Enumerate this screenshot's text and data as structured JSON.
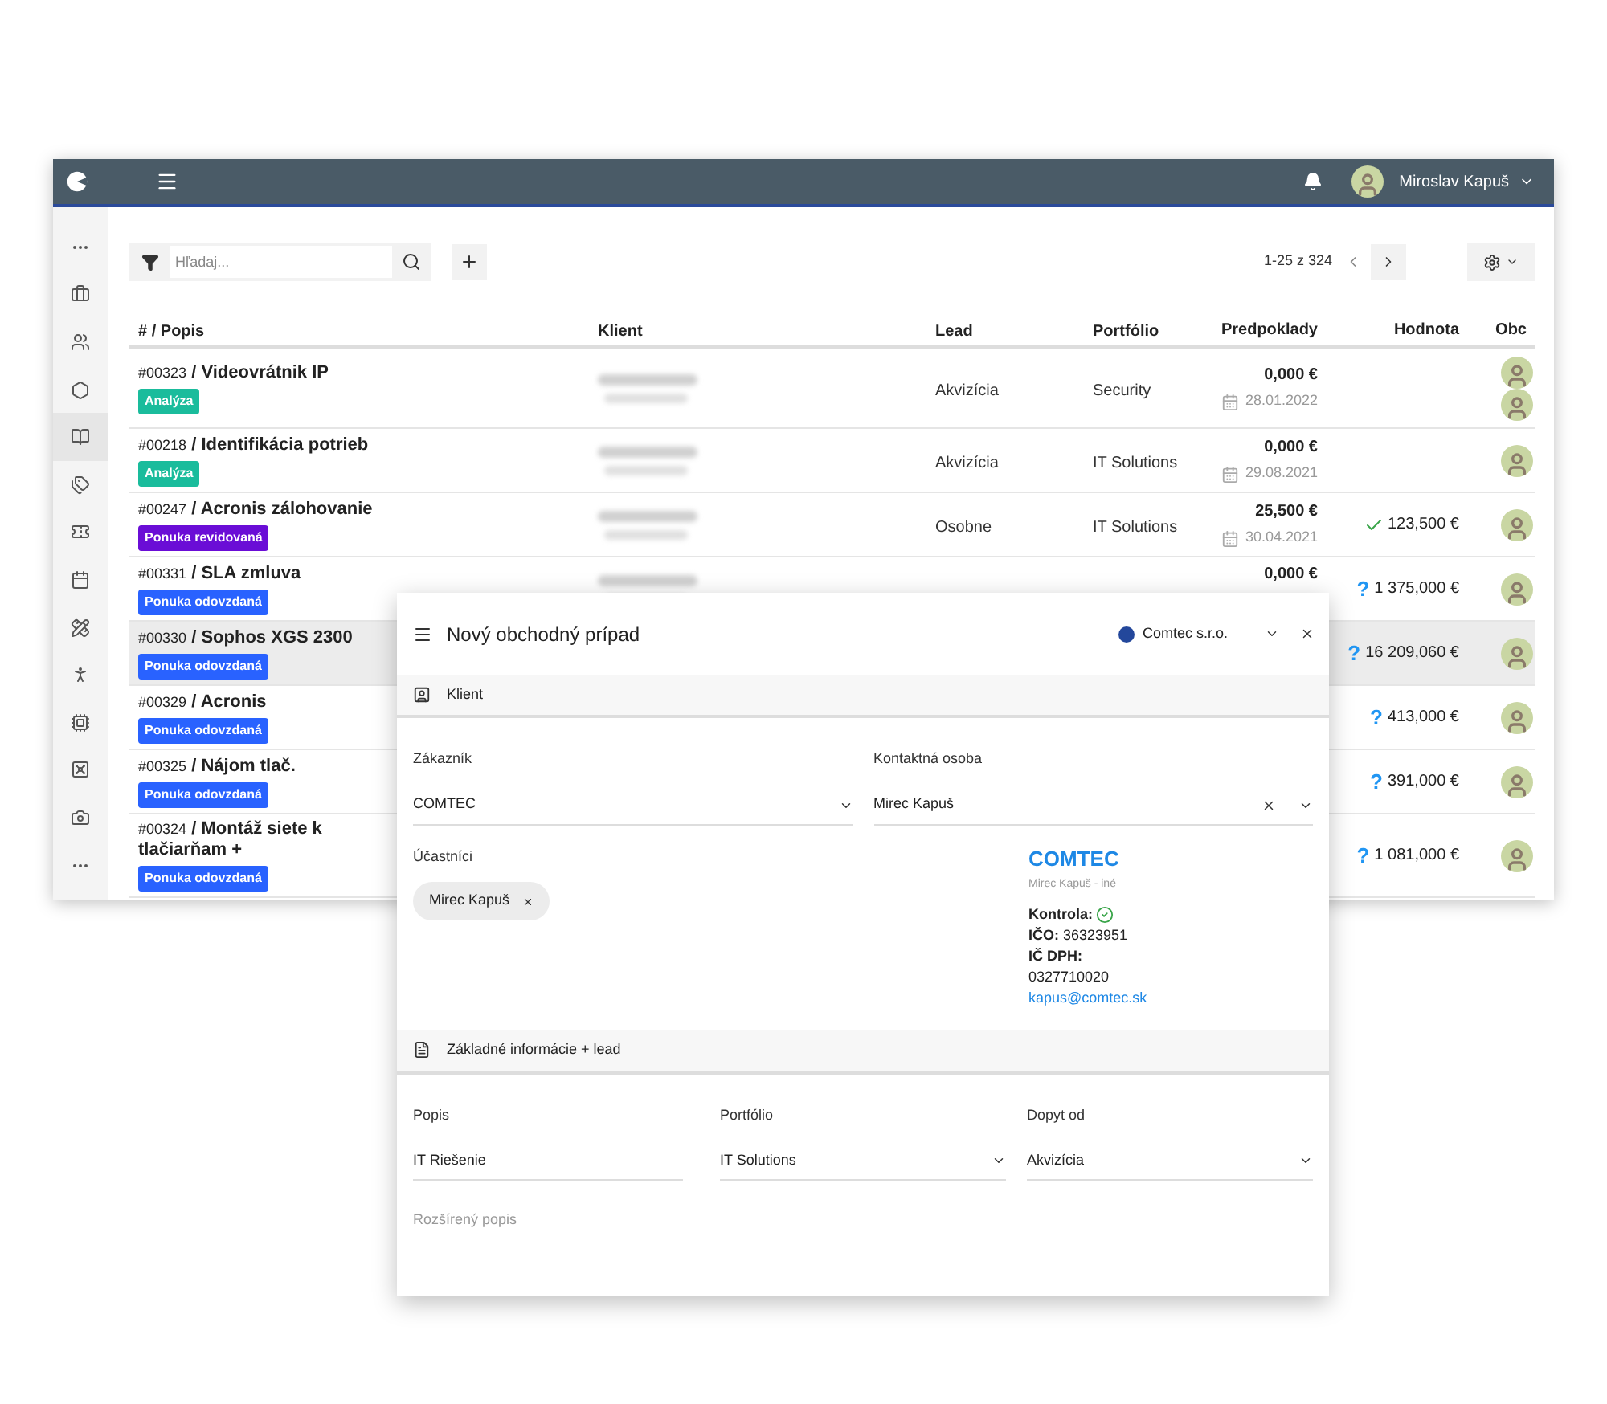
{
  "header": {
    "user_name": "Miroslav Kapuš"
  },
  "sidebar": {
    "items": [
      {
        "kind": "more",
        "selected": false
      },
      {
        "kind": "briefcase",
        "selected": false
      },
      {
        "kind": "users",
        "selected": false
      },
      {
        "kind": "hexagon",
        "selected": false
      },
      {
        "kind": "book",
        "selected": true
      },
      {
        "kind": "tags",
        "selected": false
      },
      {
        "kind": "ticket",
        "selected": false
      },
      {
        "kind": "calendar",
        "selected": false
      },
      {
        "kind": "ruler",
        "selected": false
      },
      {
        "kind": "person",
        "selected": false
      },
      {
        "kind": "chip",
        "selected": false
      },
      {
        "kind": "safe",
        "selected": false
      },
      {
        "kind": "camera",
        "selected": false
      },
      {
        "kind": "more",
        "selected": false
      }
    ]
  },
  "toolbar": {
    "search": {
      "placeholder": "Hľadaj..."
    },
    "pagination": "1-25 z 324"
  },
  "table": {
    "columns": [
      "# / Popis",
      "Klient",
      "Lead",
      "Portfólio",
      "Predpoklady",
      "Hodnota",
      "Obc"
    ],
    "rows": [
      {
        "number": "#00323",
        "title": "/ Videovrátnik IP",
        "stage": {
          "label": "Analýza",
          "color": "#1abc9c"
        },
        "lead": "Akvizícia",
        "portfolio": "Security",
        "amount": "0,000 €",
        "date": "28.01.2022",
        "owners": [
          {
            "kind": "photo"
          },
          {
            "kind": "photo"
          }
        ],
        "selected": false
      },
      {
        "number": "#00218",
        "title": "/ Identifikácia potrieb",
        "stage": {
          "label": "Analýza",
          "color": "#1abc9c"
        },
        "lead": "Akvizícia",
        "portfolio": "IT Solutions",
        "amount": "0,000 €",
        "date": "29.08.2021",
        "owners": [
          {
            "kind": "photo"
          }
        ],
        "selected": false
      },
      {
        "number": "#00247",
        "title": "/ Acronis zálohovanie",
        "stage": {
          "label": "Ponuka revidovaná",
          "color": "#6a0dd6"
        },
        "lead": "Osobne",
        "portfolio": "IT Solutions",
        "amount": "25,500 €",
        "date": "30.04.2021",
        "value": {
          "kind": "confirmed",
          "text": "123,500 €"
        },
        "owners": [
          {
            "kind": "photo"
          }
        ],
        "selected": false
      },
      {
        "number": "#00331",
        "title": "/ SLA zmluva",
        "stage": {
          "label": "Ponuka odovzdaná",
          "color": "#2962ff"
        },
        "amount": "0,000 €",
        "value": {
          "kind": "unknown",
          "marker": "?",
          "text": "1 375,000 €"
        },
        "owners": [
          {
            "kind": "photo"
          }
        ],
        "selected": false
      },
      {
        "number": "#00330",
        "title": "/ Sophos XGS 2300",
        "stage": {
          "label": "Ponuka odovzdaná",
          "color": "#2962ff"
        },
        "value": {
          "kind": "unknown",
          "marker": "?",
          "text": "16 209,060 €"
        },
        "owners": [
          {
            "kind": "photo"
          }
        ],
        "selected": true
      },
      {
        "number": "#00329",
        "title": "/ Acronis",
        "stage": {
          "label": "Ponuka odovzdaná",
          "color": "#2962ff"
        },
        "value": {
          "kind": "unknown",
          "marker": "?",
          "text": "413,000 €"
        },
        "owners": [
          {
            "kind": "photo"
          }
        ],
        "selected": false
      },
      {
        "number": "#00325",
        "title": "/ Nájom tlač.",
        "stage": {
          "label": "Ponuka odovzdaná",
          "color": "#2962ff"
        },
        "value": {
          "kind": "unknown",
          "marker": "?",
          "text": "391,000 €"
        },
        "owners": [
          {
            "kind": "photo"
          }
        ],
        "selected": false
      },
      {
        "number": "#00324",
        "title": "/ Montáž siete k tlačiarňam +",
        "stage": {
          "label": "Ponuka odovzdaná",
          "color": "#2962ff"
        },
        "value": {
          "kind": "unknown",
          "marker": "?",
          "text": "1 081,000 €"
        },
        "owners": [
          {
            "kind": "photo"
          }
        ],
        "selected": false
      }
    ]
  },
  "dialog": {
    "title": "Nový obchodný prípad",
    "company": "Comtec s.r.o.",
    "sections": [
      {
        "kind": "client",
        "title": "Klient",
        "customer": {
          "label": "Zákazník",
          "value": "COMTEC"
        },
        "contact": {
          "label": "Kontaktná osoba",
          "value": "Mirec Kapuš"
        },
        "participants": {
          "label": "Účastníci",
          "chips": [
            "Mirec Kapuš"
          ]
        },
        "card": {
          "name": "COMTEC",
          "subtitle": "Mirec Kapuš - iné",
          "check_label": "Kontrola:",
          "verified": true,
          "ico_label": "IČO:",
          "ico": "36323951",
          "dic_label": "IČ DPH:",
          "dic": "0327710020",
          "email": "kapus@comtec.sk"
        }
      },
      {
        "kind": "basic",
        "title": "Základné informácie + lead",
        "fields": [
          {
            "kind": "text",
            "label": "Popis",
            "value": "IT Riešenie"
          },
          {
            "kind": "select",
            "label": "Portfólio",
            "value": "IT Solutions"
          },
          {
            "kind": "select",
            "label": "Dopyt od",
            "value": "Akvizícia"
          }
        ],
        "description": {
          "placeholder": "Rozšírený popis"
        }
      }
    ]
  }
}
